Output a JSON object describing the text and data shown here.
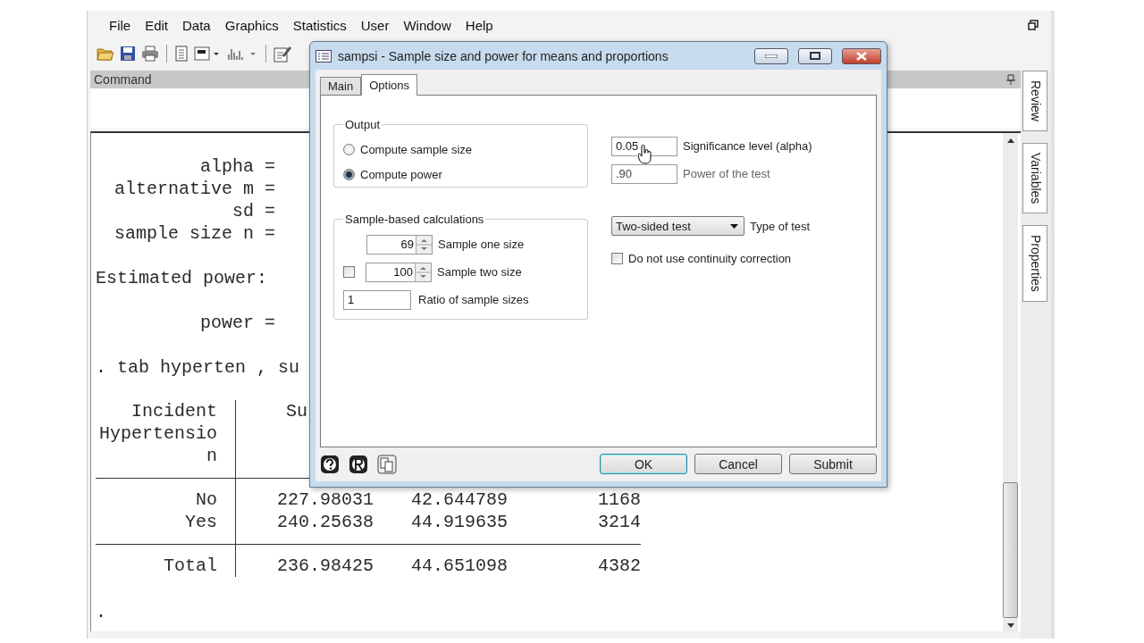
{
  "menu": [
    "File",
    "Edit",
    "Data",
    "Graphics",
    "Statistics",
    "User",
    "Window",
    "Help"
  ],
  "command_panel": {
    "title": "Command"
  },
  "results": {
    "parameters": [
      "alpha =",
      "alternative m =",
      "sd =",
      "sample size n ="
    ],
    "heading": "Estimated power:",
    "power_label": "power =",
    "command": ". tab hyperten , su",
    "table": {
      "row_header": [
        "Incident",
        "Hypertensio",
        "n"
      ],
      "column_2": "Su",
      "rows": [
        {
          "label": "No",
          "cells": [
            "227.98031",
            "42.644789",
            "1168"
          ]
        },
        {
          "label": "Yes",
          "cells": [
            "240.25638",
            "44.919635",
            "3214"
          ]
        }
      ],
      "total": {
        "label": "Total",
        "cells": [
          "236.98425",
          "44.651098",
          "4382"
        ]
      }
    },
    "prompt": "."
  },
  "side_tabs": [
    "Review",
    "Variables",
    "Properties"
  ],
  "dialog": {
    "title": "sampsi - Sample size and power for means and proportions",
    "tabs": [
      {
        "label": "Main",
        "selected": false
      },
      {
        "label": "Options",
        "selected": true
      }
    ],
    "output_group": {
      "title": "Output",
      "options": [
        {
          "label": "Compute sample size",
          "selected": false
        },
        {
          "label": "Compute power",
          "selected": true
        }
      ]
    },
    "sample_group": {
      "title": "Sample-based calculations",
      "sample_one": {
        "value": "69",
        "label": "Sample one size"
      },
      "sample_two": {
        "checked": false,
        "value": "100",
        "label": "Sample two size"
      },
      "ratio": {
        "value": "1",
        "label": "Ratio of sample sizes"
      }
    },
    "alpha": {
      "value": "0.05",
      "label": "Significance level (alpha)"
    },
    "power": {
      "value": ".90",
      "label": "Power of the test",
      "disabled": true
    },
    "test_type": {
      "value": "Two-sided test",
      "label": "Type of test"
    },
    "continuity": {
      "checked": false,
      "label": "Do not use continuity correction"
    },
    "buttons": [
      {
        "label": "OK",
        "default": true
      },
      {
        "label": "Cancel",
        "default": false
      },
      {
        "label": "Submit",
        "default": false
      }
    ]
  }
}
